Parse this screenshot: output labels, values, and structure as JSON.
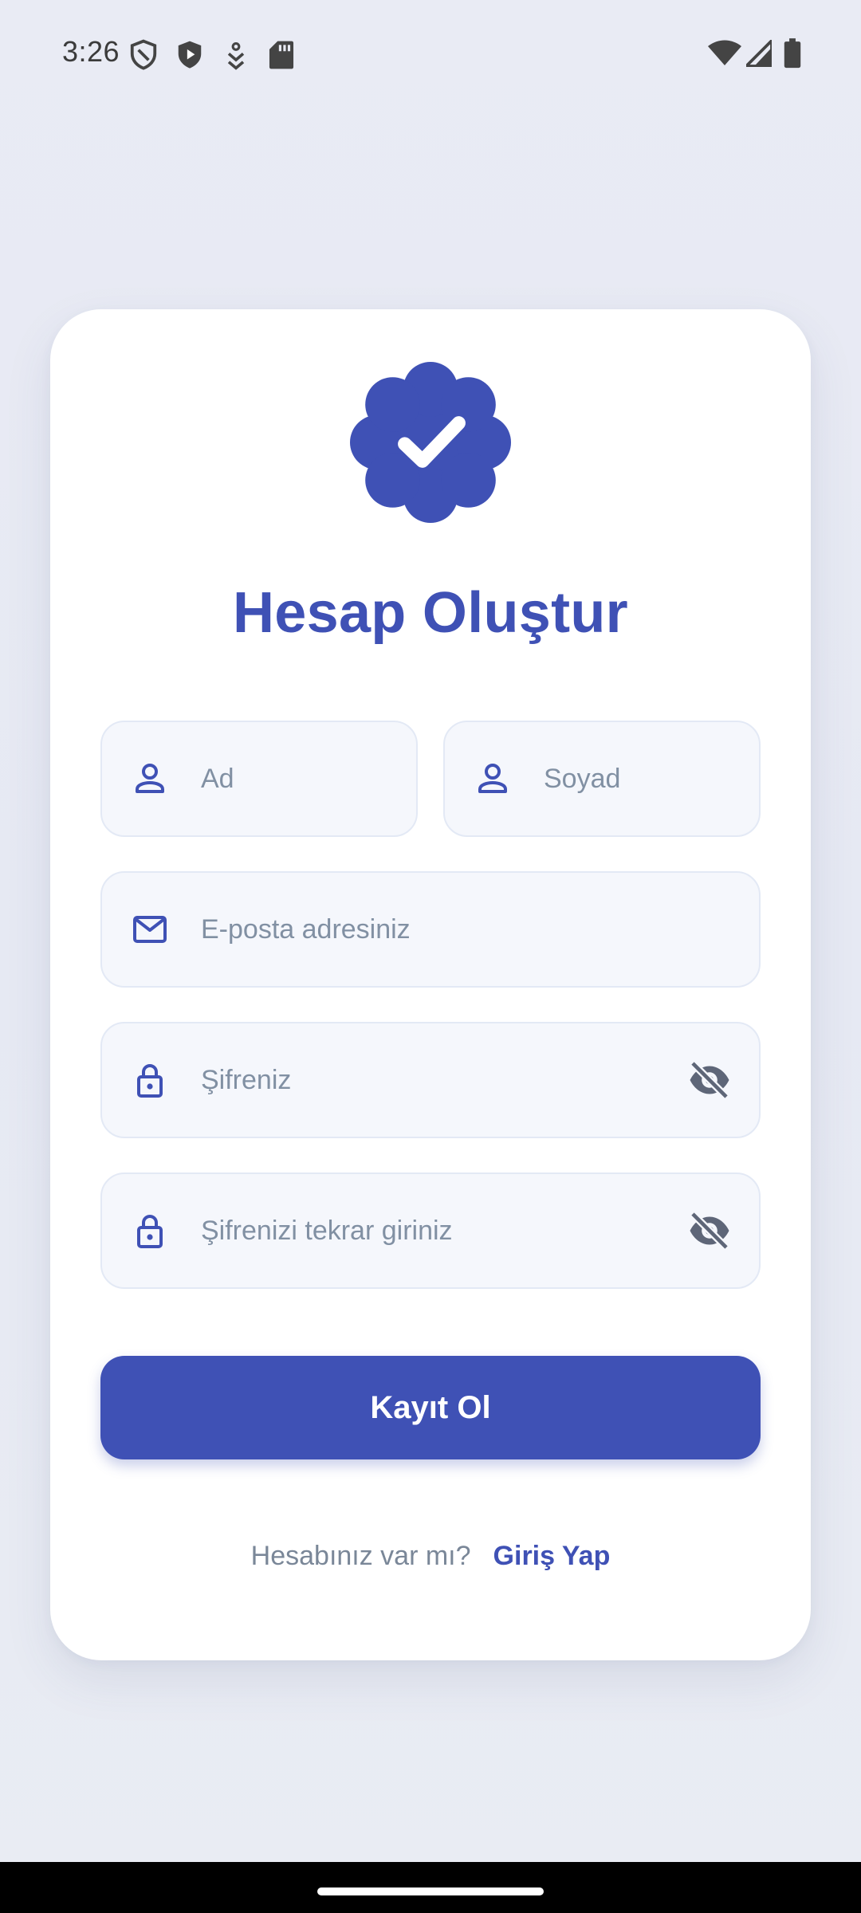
{
  "status_bar": {
    "time": "3:26",
    "left_icons": [
      "shield-outline-icon",
      "shield-play-icon",
      "download-arrow-icon",
      "sd-card-icon"
    ],
    "right_icons": [
      "wifi-icon",
      "cellular-signal-icon",
      "battery-icon"
    ]
  },
  "header": {
    "badge_icon": "verified-badge-icon",
    "title": "Hesap Oluştur"
  },
  "form": {
    "first_name": {
      "placeholder": "Ad",
      "value": "",
      "icon": "person-icon"
    },
    "last_name": {
      "placeholder": "Soyad",
      "value": "",
      "icon": "person-icon"
    },
    "email": {
      "placeholder": "E-posta adresiniz",
      "value": "",
      "icon": "mail-icon"
    },
    "password": {
      "placeholder": "Şifreniz",
      "value": "",
      "icon": "lock-icon",
      "toggle_icon": "eye-off-icon"
    },
    "password_confirm": {
      "placeholder": "Şifrenizi tekrar giriniz",
      "value": "",
      "icon": "lock-icon",
      "toggle_icon": "eye-off-icon"
    },
    "submit_label": "Kayıt Ol"
  },
  "footer": {
    "question": "Hesabınız var mı?",
    "login_link": "Giriş Yap"
  },
  "colors": {
    "primary": "#3f51b5",
    "background": "#e8eaf3",
    "field_bg": "#f5f7fc",
    "field_border": "#e3e9f5",
    "placeholder": "#8190a3",
    "muted_text": "#7a8798"
  }
}
